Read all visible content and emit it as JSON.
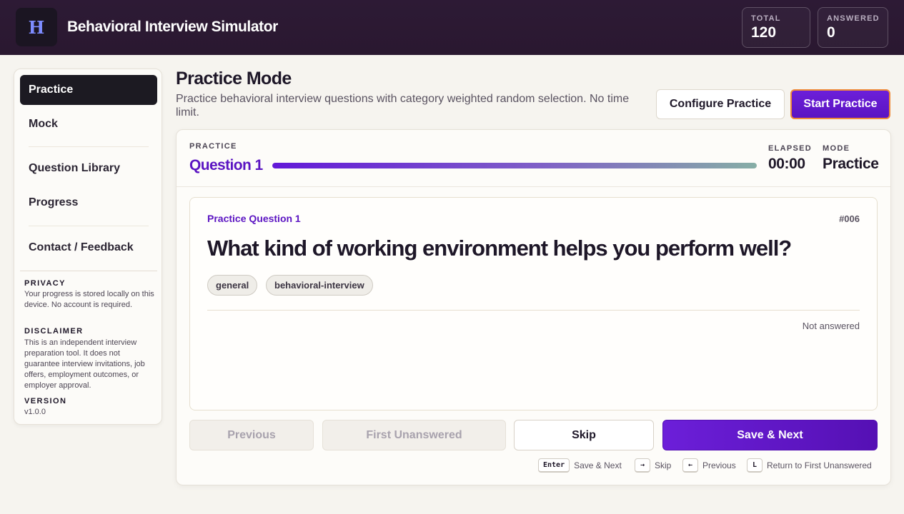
{
  "header": {
    "logo_glyph": "H",
    "app_title": "Behavioral Interview Simulator",
    "stats": [
      {
        "label": "TOTAL",
        "value": "120"
      },
      {
        "label": "ANSWERED",
        "value": "0"
      }
    ]
  },
  "sidebar": {
    "items": [
      {
        "label": "Practice",
        "active": true
      },
      {
        "label": "Mock",
        "active": false
      },
      {
        "label": "Question Library",
        "active": false
      },
      {
        "label": "Progress",
        "active": false
      },
      {
        "label": "Contact / Feedback",
        "active": false
      }
    ],
    "privacy": {
      "title": "PRIVACY",
      "text": "Your progress is stored locally on this device. No account is required."
    },
    "disclaimer": {
      "title": "DISCLAIMER",
      "text": "This is an independent interview preparation tool. It does not guarantee interview invitations, job offers, employment outcomes, or employer approval."
    },
    "version": {
      "title": "VERSION",
      "text": "v1.0.0"
    }
  },
  "page": {
    "title": "Practice Mode",
    "description": "Practice behavioral interview questions with category weighted random selection. No time limit.",
    "configure_label": "Configure Practice",
    "start_label": "Start Practice"
  },
  "session": {
    "kicker": "PRACTICE",
    "question_number": "Question 1",
    "progress": 1.0,
    "elapsed_label": "ELAPSED",
    "elapsed_value": "00:00",
    "mode_label": "MODE",
    "mode_value": "Practice"
  },
  "question": {
    "kicker": "Practice Question 1",
    "id": "#006",
    "text": "What kind of working environment helps you perform well?",
    "tags": [
      "general",
      "behavioral-interview"
    ],
    "status": "Not answered"
  },
  "actions": {
    "previous": "Previous",
    "first_unanswered": "First Unanswered",
    "skip": "Skip",
    "save_next": "Save & Next"
  },
  "shortcuts": [
    {
      "key": "Enter",
      "label": "Save & Next"
    },
    {
      "key": "→",
      "label": "Skip"
    },
    {
      "key": "←",
      "label": "Previous"
    },
    {
      "key": "L",
      "label": "Return to First Unanswered"
    }
  ],
  "colors": {
    "accent": "#5b14c2",
    "header_bg": "#2d1a35",
    "start_border": "#ee8a3a"
  }
}
